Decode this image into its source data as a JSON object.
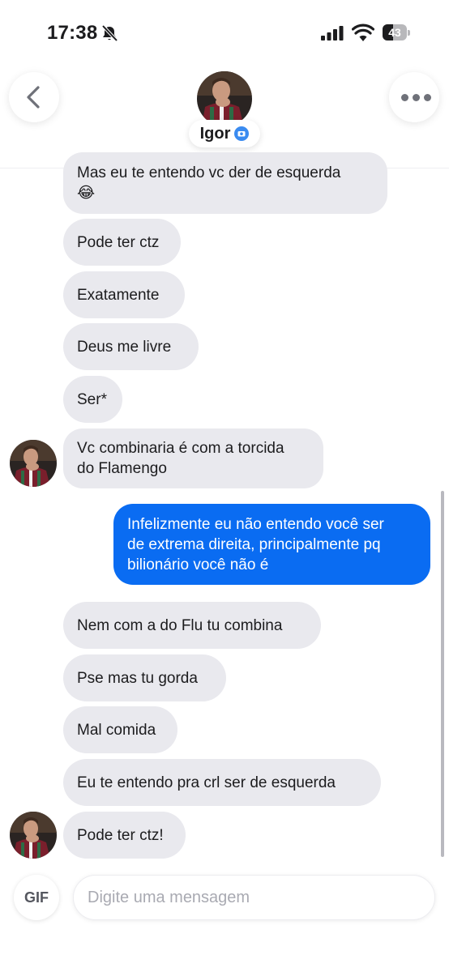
{
  "status_bar": {
    "time": "17:38",
    "battery": "43",
    "battery_level": 0.43
  },
  "header": {
    "contact_name": "Igor",
    "back_icon": "chevron-left-icon",
    "more_icon": "more-dots-icon",
    "verified_icon": "verified-camera-badge-icon"
  },
  "messages": [
    {
      "from": "contact",
      "text": "Mas eu te entendo vc der de esquerda\n😂"
    },
    {
      "from": "contact",
      "text": "Pode ter ctz"
    },
    {
      "from": "contact",
      "text": "Exatamente"
    },
    {
      "from": "contact",
      "text": "Deus me livre"
    },
    {
      "from": "contact",
      "text": "Ser*"
    },
    {
      "from": "contact",
      "text": "Vc combinaria é com a torcida\ndo Flamengo"
    },
    {
      "from": "me",
      "text": "Infelizmente eu não entendo você ser\nde extrema direita, principalmente pq\nbilionário você não é"
    },
    {
      "from": "contact",
      "text": "Nem com a do Flu tu combina"
    },
    {
      "from": "contact",
      "text": "Pse mas tu gorda"
    },
    {
      "from": "contact",
      "text": "Mal comida"
    },
    {
      "from": "contact",
      "text": "Eu te entendo pra crl ser de esquerda"
    },
    {
      "from": "contact",
      "text": "Pode ter ctz!"
    }
  ],
  "composer": {
    "gif_label": "GIF",
    "placeholder": "Digite uma mensagem"
  },
  "colors": {
    "outgoing_bubble": "#0a6cf2",
    "incoming_bubble": "#e9e9ee",
    "verified_badge": "#3a8bf0"
  }
}
